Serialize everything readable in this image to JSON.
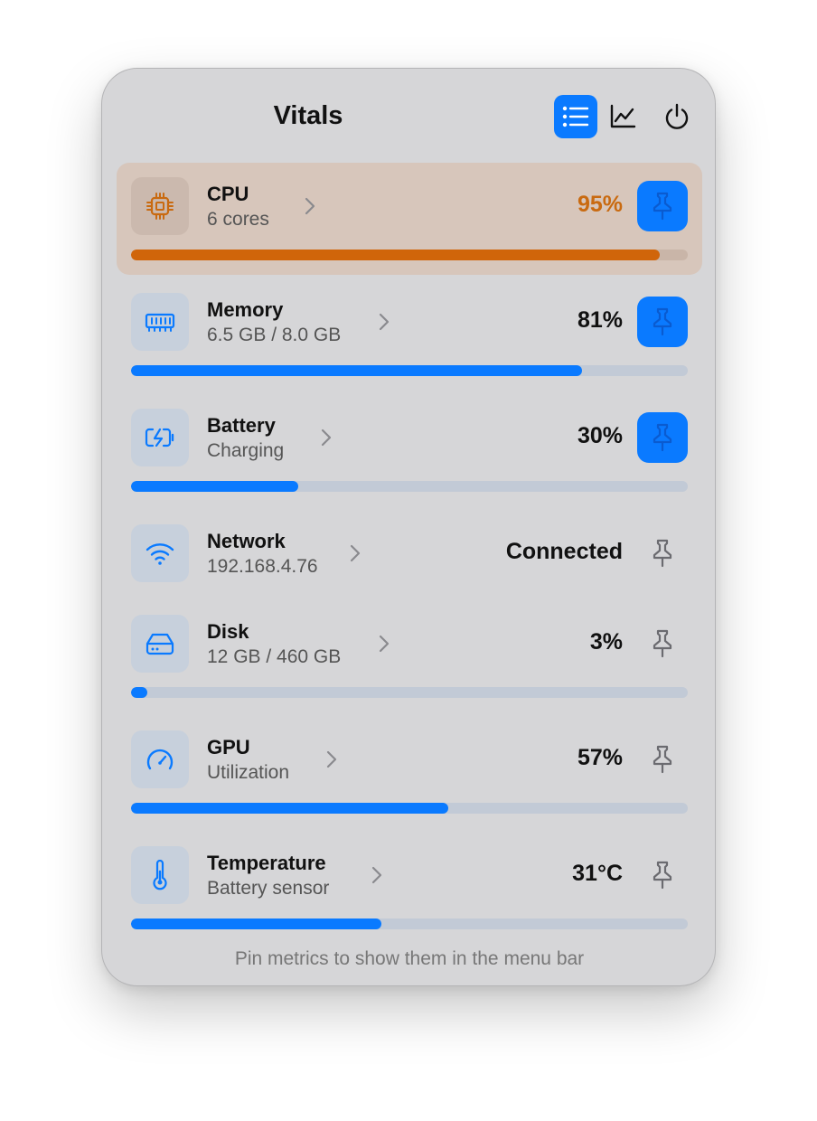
{
  "header": {
    "title": "Vitals",
    "buttons": [
      {
        "icon": "list-icon",
        "active": true
      },
      {
        "icon": "chart-icon",
        "active": false
      },
      {
        "icon": "power-icon",
        "active": false
      }
    ]
  },
  "metrics": [
    {
      "name": "CPU",
      "detail": "6 cores",
      "value": "95%",
      "level": 0.95,
      "pinned": true,
      "highlighted": true,
      "icon": "cpu-icon"
    },
    {
      "name": "Memory",
      "detail": "6.5 GB / 8.0 GB",
      "value": "81%",
      "level": 0.81,
      "pinned": true,
      "highlighted": false,
      "icon": "memory-icon"
    },
    {
      "name": "Battery",
      "detail": "Charging",
      "value": "30%",
      "level": 0.3,
      "pinned": true,
      "highlighted": false,
      "icon": "battery-charging-icon"
    },
    {
      "name": "Network",
      "detail": "192.168.4.76",
      "value": "Connected",
      "level": null,
      "pinned": false,
      "highlighted": false,
      "icon": "wifi-icon"
    },
    {
      "name": "Disk",
      "detail": "12 GB / 460 GB",
      "value": "3%",
      "level": 0.03,
      "pinned": false,
      "highlighted": false,
      "icon": "disk-icon"
    },
    {
      "name": "GPU",
      "detail": "Utilization",
      "value": "57%",
      "level": 0.57,
      "pinned": false,
      "highlighted": false,
      "icon": "gauge-icon"
    },
    {
      "name": "Temperature",
      "detail": "Battery sensor",
      "value": "31°C",
      "level": 0.45,
      "pinned": false,
      "highlighted": false,
      "icon": "thermometer-icon"
    }
  ],
  "footer": {
    "text": "Pin metrics to show them in the menu bar"
  },
  "colors": {
    "accent": "#0a7aff",
    "warning": "#c96a10",
    "warning_fill": "#d0650a"
  }
}
